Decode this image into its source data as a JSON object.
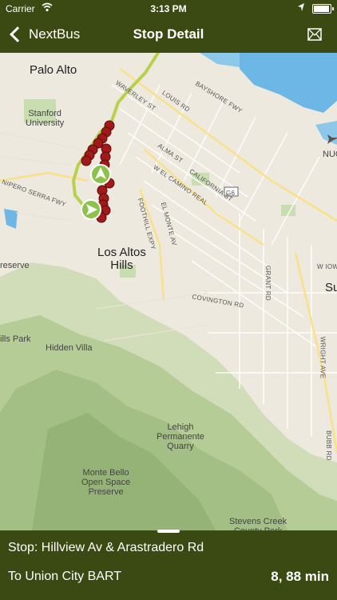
{
  "status_bar": {
    "carrier": "Carrier",
    "time": "3:13 PM",
    "wifi_icon": "wifi-icon",
    "location_icon": "location-arrow-icon",
    "battery_icon": "battery-icon"
  },
  "nav": {
    "back_label": "NextBus",
    "title": "Stop Detail",
    "action_icon": "mail-icon"
  },
  "map": {
    "labels": {
      "palo_alto": "Palo Alto",
      "stanford": "Stanford\nUniversity",
      "los_altos_hills": "Los Altos\nHills",
      "hidden_villa": "Hidden Villa",
      "lehigh": "Lehigh\nPermanente\nQuarry",
      "monte_bello": "Monte Bello\nOpen Space\nPreserve",
      "stevens_creek": "Stevens Creek\nCounty Park",
      "hills_park": "ills Park",
      "preserve": "reserve",
      "nuc": "NUC",
      "su": "Su",
      "g6": "G6",
      "waverley": "WAVERLEY ST",
      "louis": "LOUIS RD",
      "bayshore": "BAYSHORE FWY",
      "alma": "ALMA ST",
      "el_camino": "W EL CAMINO REAL",
      "california": "CALIFORNIA ST",
      "foothill": "FOOTHILL EXPY",
      "el_monte": "EL MONTE AV",
      "covington": "COVINGTON RD",
      "grant": "GRANT RD",
      "wright": "WRIGHT AVE",
      "bubb": "BUBB RD",
      "w_iowa": "W IOWA",
      "junipero": "NIPERO SERRA FWY"
    }
  },
  "bottom": {
    "stop_line": "Stop: Hillview Av & Arastradero Rd",
    "destination": "To Union City BART",
    "predictions": "8, 88 min"
  }
}
